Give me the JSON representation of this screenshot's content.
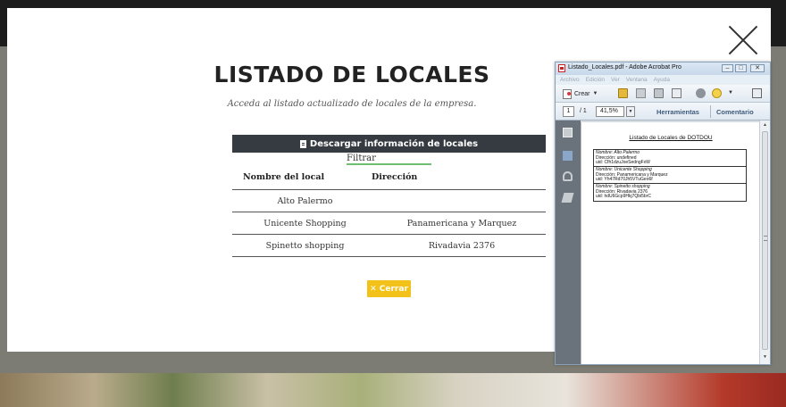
{
  "modal": {
    "title": "LISTADO DE LOCALES",
    "subtitle": "Acceda al listado actualizado de locales de la empresa.",
    "download_label": "Descargar información de locales",
    "filter_placeholder": "Filtrar",
    "columns": [
      "Nombre del local",
      "Dirección"
    ],
    "rows": [
      {
        "name": "Alto Palermo",
        "address": ""
      },
      {
        "name": "Unicente Shopping",
        "address": "Panamericana y Marquez"
      },
      {
        "name": "Spinetto shopping",
        "address": "Rivadavia 2376"
      }
    ],
    "close_label": "✕ Cerrar"
  },
  "acrobat": {
    "window_title": "Listado_Locales.pdf - Adobe Acrobat Pro",
    "menu": [
      "Archivo",
      "Edición",
      "Ver",
      "Ventana",
      "Ayuda"
    ],
    "create_label": "Crear",
    "page_current": "1",
    "page_total": "/ 1",
    "zoom": "41,5%",
    "tools_label": "Herramientas",
    "comment_label": "Comentario",
    "pdf": {
      "heading": "Listado de Locales de DOTDOU",
      "entries": [
        {
          "name": "Nombre: Alto Palermo",
          "address": "Dirección: undefined",
          "uid": "uid: Cfh1dzuJoeSedngFxW"
        },
        {
          "name": "Nombre: Unicente Shopping",
          "address": "Dirección: Panamericana y Marquez",
          "uid": "uid: Yh47Rd70Jh5VTuGeo6f"
        },
        {
          "name": "Nombre: Spinetto shopping",
          "address": "Dirección: Rivadavia 2376",
          "uid": "uid: hdU6Gcp9Hkj7Qbi5brC"
        }
      ]
    }
  },
  "colors": {
    "download_bg": "#363b41",
    "close_bg": "#f2c21a",
    "filter_underline": "#6fbf73",
    "acrobat_link": "#3d5a7a"
  },
  "icons": [
    "close-icon",
    "document-icon",
    "pdf-icon",
    "folder-icon",
    "save-icon",
    "print-icon",
    "mail-icon",
    "gear-icon",
    "comment-icon",
    "expand-icon",
    "pages-icon",
    "bookmark-icon",
    "attachment-icon",
    "signature-icon"
  ]
}
